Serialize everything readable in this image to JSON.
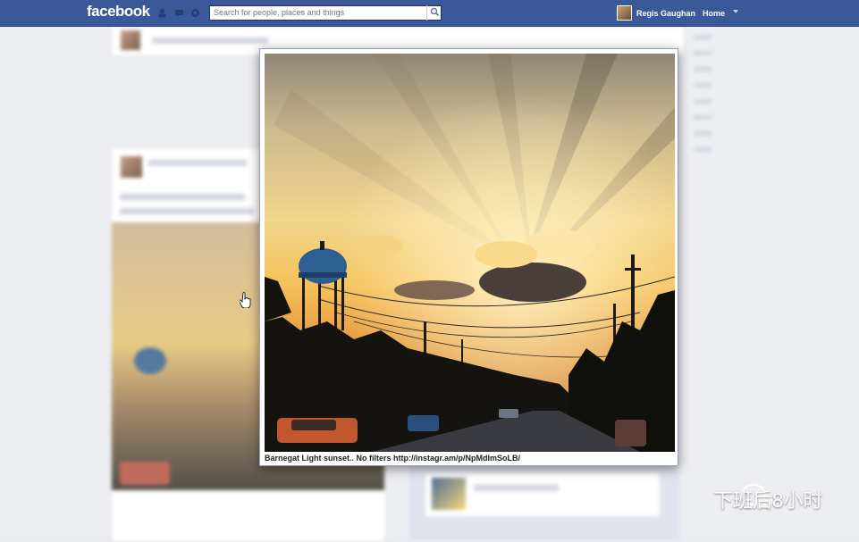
{
  "topbar": {
    "logo": "facebook",
    "search_placeholder": "Search for people, places and things",
    "user_name": "Regis Gaughan",
    "home_label": "Home",
    "brand_color": "#3b5998"
  },
  "viewer": {
    "caption": "Barnegat Light sunset.. No filters http://instagr.am/p/NpMdImSoLB/"
  },
  "watermark": {
    "text": "下班后8小时",
    "icon": "wechat-icon"
  },
  "icons": [
    "friend-requests-icon",
    "messages-icon",
    "notifications-icon",
    "search-icon",
    "chevron-down-icon",
    "hand-cursor-icon"
  ]
}
